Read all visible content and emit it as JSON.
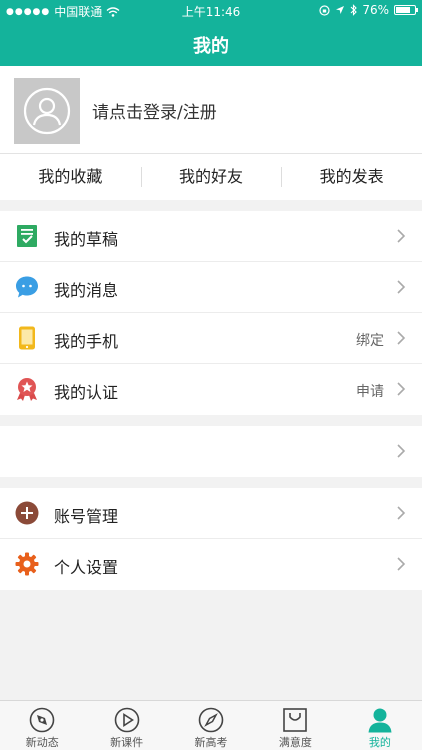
{
  "status_bar": {
    "carrier": "中国联通",
    "time": "上午11:46",
    "battery_text": "76%",
    "battery_level": 0.76
  },
  "nav": {
    "title": "我的"
  },
  "profile": {
    "login_text": "请点击登录/注册"
  },
  "tabs": [
    {
      "label": "我的收藏"
    },
    {
      "label": "我的好友"
    },
    {
      "label": "我的发表"
    }
  ],
  "menu_group_1": [
    {
      "label": "我的草稿",
      "value": "",
      "icon": "draft-icon"
    },
    {
      "label": "我的消息",
      "value": "",
      "icon": "message-icon"
    },
    {
      "label": "我的手机",
      "value": "绑定",
      "icon": "phone-icon"
    },
    {
      "label": "我的认证",
      "value": "申请",
      "icon": "certification-icon"
    }
  ],
  "menu_group_2": [
    {
      "label": "",
      "value": ""
    }
  ],
  "menu_group_3": [
    {
      "label": "账号管理",
      "value": "",
      "icon": "account-plus-icon"
    },
    {
      "label": "个人设置",
      "value": "",
      "icon": "settings-gear-icon"
    }
  ],
  "tabbar": [
    {
      "label": "新动态",
      "icon": "news-icon"
    },
    {
      "label": "新课件",
      "icon": "play-icon"
    },
    {
      "label": "新高考",
      "icon": "compass-icon"
    },
    {
      "label": "满意度",
      "icon": "bag-icon"
    },
    {
      "label": "我的",
      "icon": "person-icon",
      "active": true
    }
  ],
  "colors": {
    "accent": "#14b39b"
  }
}
